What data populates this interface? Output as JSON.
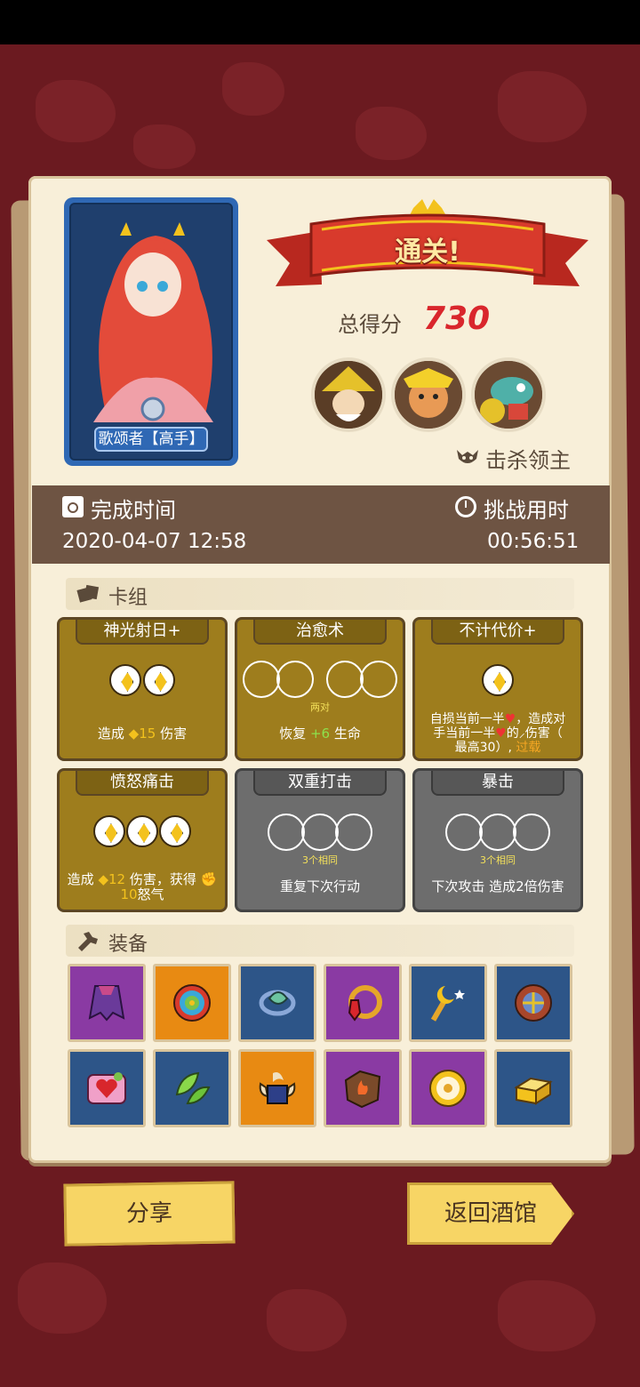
{
  "hero": {
    "name": "歌颂者【高手】"
  },
  "result": {
    "banner": "通关!",
    "score_label": "总得分",
    "score_value": "730"
  },
  "bosses": {
    "label": "击杀领主",
    "icons": [
      "boss-1-icon",
      "boss-2-icon",
      "boss-3-icon"
    ]
  },
  "times": {
    "finish_label": "完成时间",
    "finish_value": "2020-04-07 12:58",
    "challenge_label": "挑战用时",
    "challenge_value": "00:56:51"
  },
  "deck": {
    "title": "卡组",
    "cards": [
      {
        "name": "神光射日+",
        "desc_pre": "造成",
        "num": "15",
        "desc_post": "伤害"
      },
      {
        "name": "治愈术",
        "note": "两对",
        "desc_pre": "恢复",
        "num": "+6",
        "desc_post": "生命"
      },
      {
        "name": "不计代价+",
        "line1": "自损当前一半",
        "line1b": "，造成对",
        "line2": "手当前一半",
        "line2b": "的",
        "line2c": "伤害（",
        "line3": "最高30）,",
        "line3b": "过载"
      },
      {
        "name": "愤怒痛击",
        "desc_pre": "造成",
        "num": "12",
        "desc_mid": "伤害，获得",
        "num2": "10",
        "desc_post": "怒气"
      },
      {
        "name": "双重打击",
        "note": "3个相同",
        "desc": "重复下次行动"
      },
      {
        "name": "暴击",
        "note": "3个相同",
        "desc": "下次攻击 造成2倍伤害"
      }
    ]
  },
  "equipment": {
    "title": "装备",
    "items": [
      {
        "icon": "cape-icon",
        "color": "purple"
      },
      {
        "icon": "swirl-orb-icon",
        "color": "orange"
      },
      {
        "icon": "leaf-amulet-icon",
        "color": "blue"
      },
      {
        "icon": "ruby-ring-icon",
        "color": "purple"
      },
      {
        "icon": "moon-wand-icon",
        "color": "blue"
      },
      {
        "icon": "shield-icon",
        "color": "blue"
      },
      {
        "icon": "heart-box-icon",
        "color": "blue"
      },
      {
        "icon": "leaves-icon",
        "color": "blue"
      },
      {
        "icon": "horned-helmet-icon",
        "color": "orange"
      },
      {
        "icon": "fire-stone-icon",
        "color": "purple"
      },
      {
        "icon": "sun-disc-icon",
        "color": "purple"
      },
      {
        "icon": "gold-bar-icon",
        "color": "blue"
      }
    ]
  },
  "buttons": {
    "share": "分享",
    "return": "返回酒馆"
  }
}
